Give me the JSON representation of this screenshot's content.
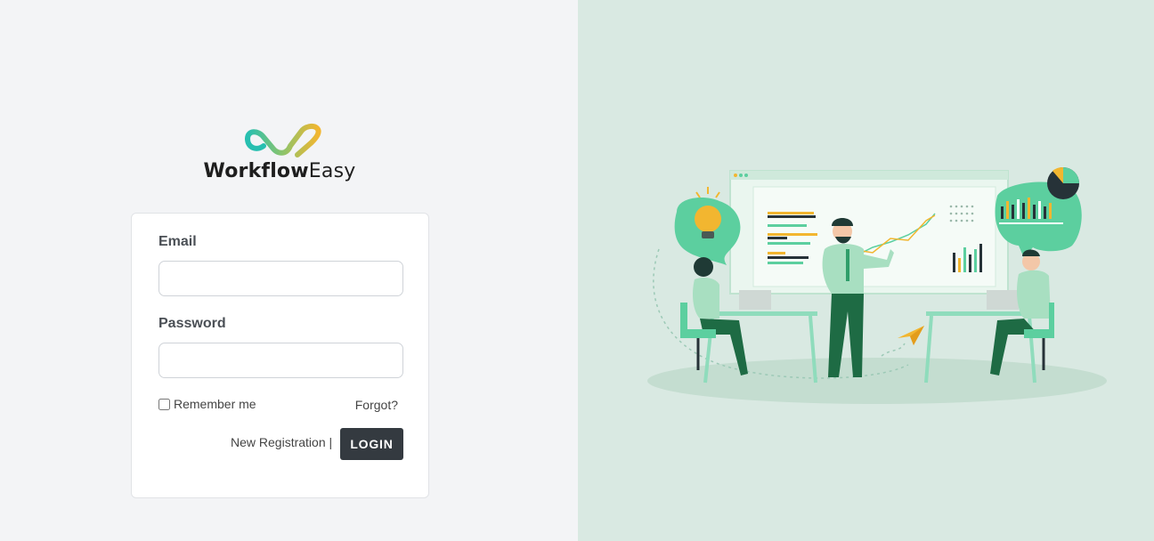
{
  "brand": {
    "name_part1": "Workflow",
    "name_part2": "Easy",
    "colors": {
      "teal": "#3fc1b0",
      "gold": "#f2b630"
    }
  },
  "login_form": {
    "email_label": "Email",
    "email_value": "",
    "password_label": "Password",
    "password_value": "",
    "remember_label": "Remember me",
    "remember_checked": false,
    "forgot_link": "Forgot?",
    "new_registration_link": "New Registration |",
    "login_button": "LOGIN"
  },
  "theme": {
    "left_background": "#f3f4f6",
    "right_background": "#d9e9e2",
    "button_color": "#343a40",
    "accent_green": "#5ccf9f"
  },
  "illustration": {
    "icon": "team-dashboard-illustration"
  }
}
